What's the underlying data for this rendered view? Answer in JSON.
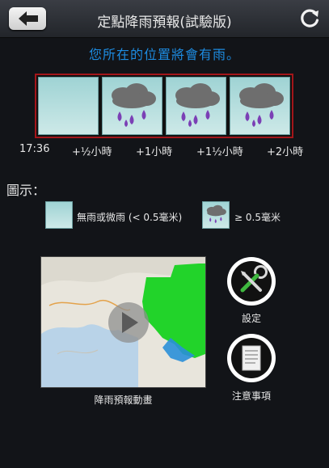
{
  "header": {
    "title": "定點降雨預報(試驗版)",
    "back_icon": "back-arrow-icon",
    "refresh_icon": "refresh-icon"
  },
  "notice": "您所在的位置將會有雨。",
  "forecast": {
    "frames": [
      {
        "state": "no-rain"
      },
      {
        "state": "rain"
      },
      {
        "state": "rain"
      },
      {
        "state": "rain"
      }
    ],
    "times": [
      "17:36",
      "+½小時",
      "+1小時",
      "+1½小時",
      "+2小時"
    ]
  },
  "legend": {
    "title": "圖示：",
    "no_rain": "無雨或微雨 (< 0.5毫米)",
    "rain": "≥ 0.5毫米"
  },
  "map": {
    "caption": "降雨預報動畫",
    "play_icon": "play-icon"
  },
  "actions": {
    "settings": "設定",
    "notes": "注意事項"
  },
  "colors": {
    "notice": "#1d8be0",
    "frame_border": "#a3161a",
    "rain_drop": "#7b3fb5",
    "radar_green": "#22d32a",
    "radar_blue": "#2a8fd8"
  }
}
